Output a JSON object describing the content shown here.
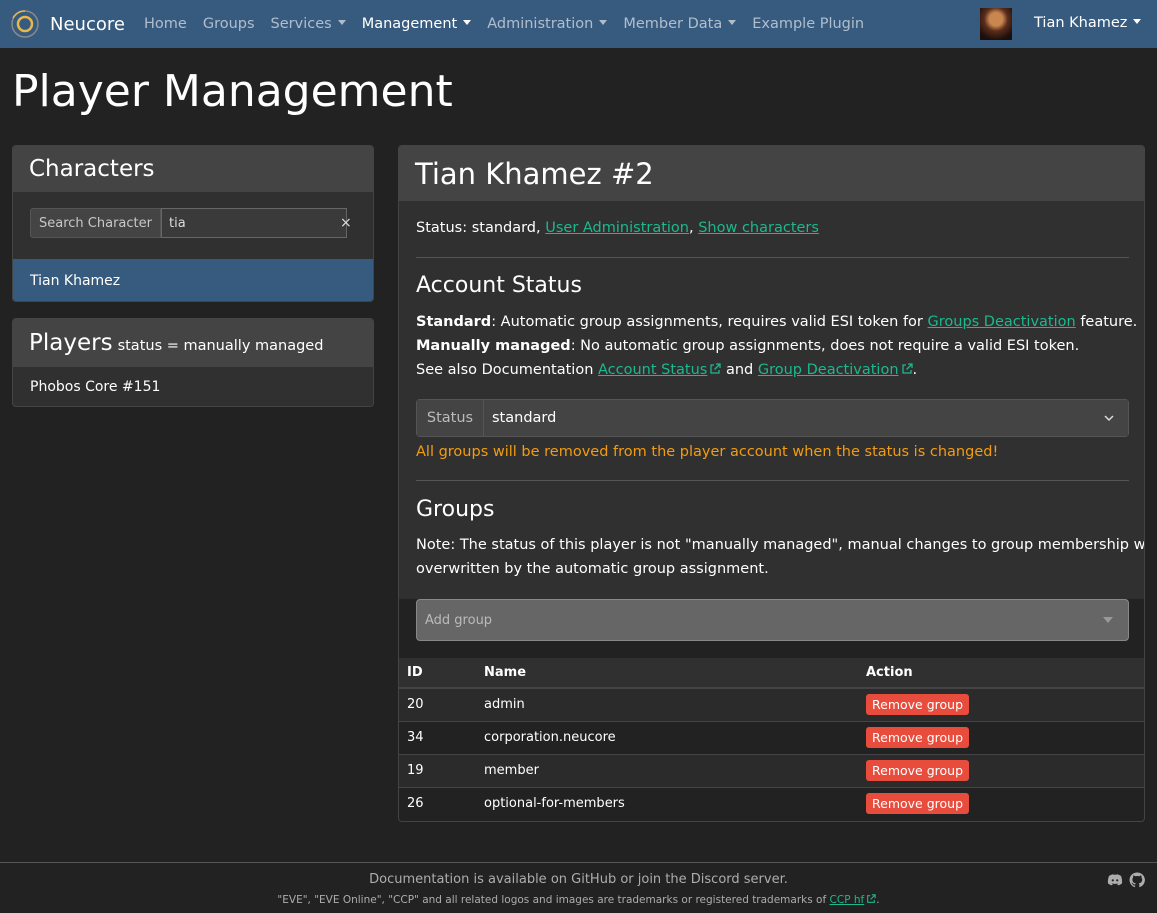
{
  "navbar": {
    "brand": "Neucore",
    "items": [
      {
        "label": "Home",
        "active": false,
        "dropdown": false
      },
      {
        "label": "Groups",
        "active": false,
        "dropdown": false
      },
      {
        "label": "Services",
        "active": false,
        "dropdown": true
      },
      {
        "label": "Management",
        "active": true,
        "dropdown": true
      },
      {
        "label": "Administration",
        "active": false,
        "dropdown": true
      },
      {
        "label": "Member Data",
        "active": false,
        "dropdown": true
      },
      {
        "label": "Example Plugin",
        "active": false,
        "dropdown": false
      }
    ],
    "user": "Tian Khamez"
  },
  "page_title": "Player Management",
  "characters": {
    "title": "Characters",
    "search_label": "Search Character",
    "search_value": "tia",
    "clear": "×",
    "results": [
      "Tian Khamez"
    ]
  },
  "players": {
    "title": "Players",
    "subtitle": "status = manually managed",
    "items": [
      "Phobos Core #151"
    ]
  },
  "player": {
    "title": "Tian Khamez #2",
    "status_prefix": "Status: standard,",
    "link_user_admin": "User Administration",
    "comma": ",",
    "link_show_chars": "Show characters",
    "account_status": {
      "title": "Account Status",
      "standard_bold": "Standard",
      "standard_text": ": Automatic group assignments, requires valid ESI token for",
      "standard_link": "Groups Deactivation",
      "standard_end": "feature.",
      "manual_bold": "Manually managed",
      "manual_text": ": No automatic group assignments, does not require a valid ESI token.",
      "see_also": "See also Documentation",
      "doc_link1": "Account Status",
      "and": "and",
      "doc_link2": "Group Deactivation",
      "period": ".",
      "select_label": "Status",
      "select_value": "standard",
      "warning": "All groups will be removed from the player account when the status is changed!"
    },
    "groups": {
      "title": "Groups",
      "note_line1": "Note: The status of this player is not \"manually managed\", manual changes to group membership will be",
      "note_line2": "overwritten by the automatic group assignment.",
      "add_placeholder": "Add group",
      "columns": [
        "ID",
        "Name",
        "Action"
      ],
      "rows": [
        {
          "id": "20",
          "name": "admin",
          "action": "Remove group"
        },
        {
          "id": "34",
          "name": "corporation.neucore",
          "action": "Remove group"
        },
        {
          "id": "19",
          "name": "member",
          "action": "Remove group"
        },
        {
          "id": "26",
          "name": "optional-for-members",
          "action": "Remove group"
        }
      ]
    }
  },
  "footer": {
    "line1": "Documentation is available on GitHub or join the Discord server.",
    "line2": "\"EVE\", \"EVE Online\", \"CCP\" and all related logos and images are trademarks or registered trademarks of",
    "line2_link": "CCP hf",
    "line2_end": ".",
    "icons": [
      "discord-icon",
      "github-icon"
    ]
  },
  "colors": {
    "navbar": "#375a7f",
    "background": "#222222",
    "link": "#1bb98d",
    "warning": "#f39c12",
    "danger": "#e74c3c"
  }
}
